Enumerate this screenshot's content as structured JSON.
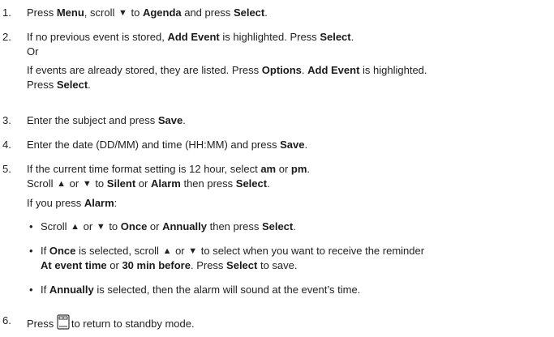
{
  "steps": [
    {
      "num": "1.",
      "parts": [
        "Press ",
        "Menu",
        ", scroll ",
        "▼",
        " to ",
        "Agenda",
        " and press ",
        "Select",
        "."
      ]
    },
    {
      "num": "2.",
      "line1": [
        "If no previous event is stored, ",
        "Add Event",
        " is highlighted. Press ",
        "Select",
        "."
      ],
      "or": "Or",
      "line3": [
        "If events are already stored, they are listed. Press ",
        "Options",
        ". ",
        "Add Event",
        " is highlighted."
      ],
      "line4": [
        "Press ",
        "Select",
        "."
      ]
    },
    {
      "num": "3.",
      "parts": [
        "Enter the subject and press ",
        "Save",
        "."
      ]
    },
    {
      "num": "4.",
      "parts": [
        "Enter the date (DD/MM) and time (HH:MM) and press ",
        "Save",
        "."
      ]
    },
    {
      "num": "5.",
      "line1": [
        "If the current time format setting is 12 hour, select ",
        "am",
        " or ",
        "pm",
        "."
      ],
      "line2": [
        "Scroll ",
        "▲",
        " or ",
        "▼",
        " to ",
        "Silent",
        " or ",
        "Alarm",
        " then press ",
        "Select",
        "."
      ],
      "line3": [
        "If you press ",
        "Alarm",
        ":"
      ],
      "bullets": [
        {
          "dot": "•",
          "line1": [
            "Scroll ",
            "▲",
            " or ",
            "▼",
            " to ",
            "Once",
            " or ",
            "Annually",
            " then press ",
            "Select",
            "."
          ]
        },
        {
          "dot": "•",
          "line1": [
            "If ",
            "Once",
            " is selected, scroll ",
            "▲",
            " or ",
            "▼",
            " to select when you want to receive the reminder"
          ],
          "line2": [
            "At event time",
            " or ",
            "30 min before",
            ". Press ",
            "Select",
            " to save."
          ]
        },
        {
          "dot": "•",
          "line1": [
            "If ",
            "Annually",
            " is selected, then the alarm will sound at the event’s time."
          ]
        }
      ]
    },
    {
      "num": "6.",
      "pre": "Press ",
      "post": "to return to standby mode.",
      "icon": "end-call-phone-icon"
    }
  ]
}
